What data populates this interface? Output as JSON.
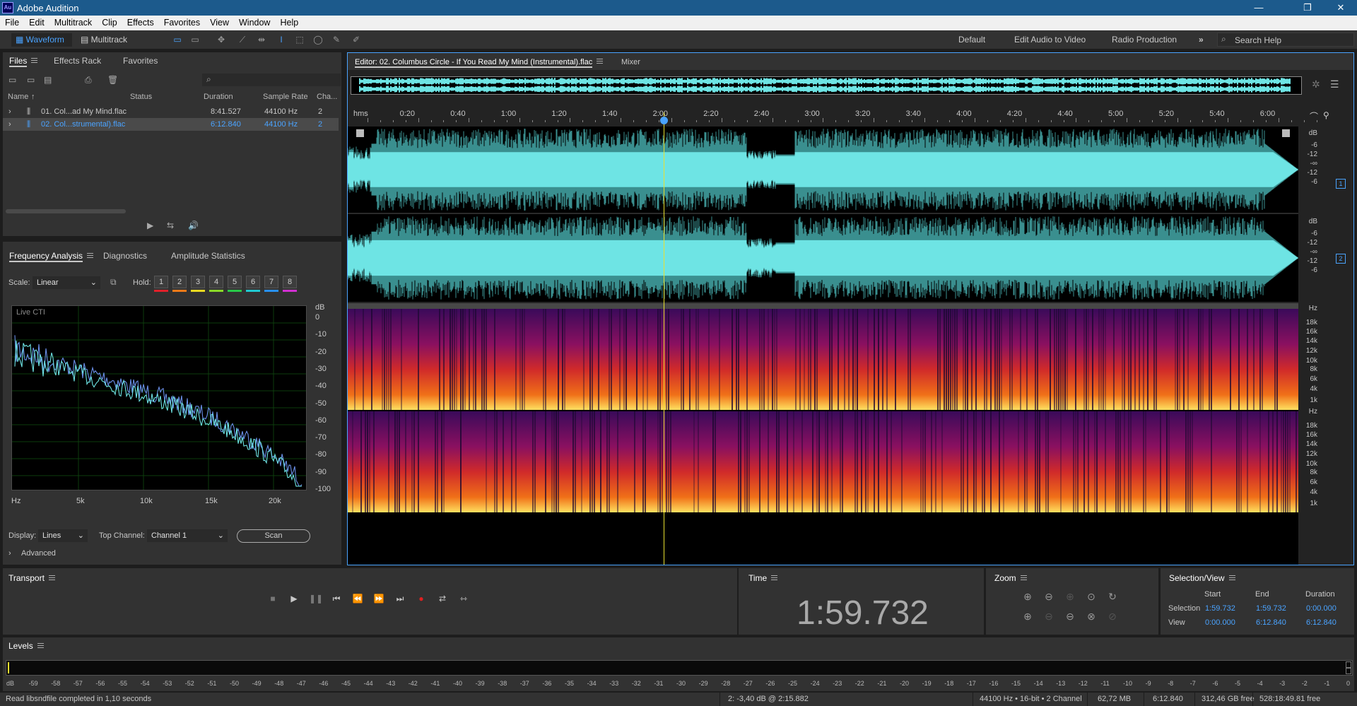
{
  "app": {
    "title": "Adobe Audition",
    "logo": "Au"
  },
  "window_controls": [
    "—",
    "❐",
    "✕"
  ],
  "menu": [
    "File",
    "Edit",
    "Multitrack",
    "Clip",
    "Effects",
    "Favorites",
    "View",
    "Window",
    "Help"
  ],
  "toolbar": {
    "waveform": "Waveform",
    "multitrack": "Multitrack",
    "workspaces": [
      "Default",
      "Edit Audio to Video",
      "Radio Production"
    ],
    "more": "»",
    "search_placeholder": "Search Help"
  },
  "files_panel": {
    "tabs": [
      "Files",
      "Effects Rack",
      "Favorites"
    ],
    "columns": [
      "Name",
      "Status",
      "Duration",
      "Sample Rate",
      "Cha..."
    ],
    "rows": [
      {
        "name": "01. Col...ad My Mind.flac",
        "status": "",
        "duration": "8:41.527",
        "rate": "44100 Hz",
        "ch": "2"
      },
      {
        "name": "02. Col...strumental).flac",
        "status": "",
        "duration": "6:12.840",
        "rate": "44100 Hz",
        "ch": "2"
      }
    ],
    "search_icon": "search-icon"
  },
  "freq_panel": {
    "tabs": [
      "Frequency Analysis",
      "Diagnostics",
      "Amplitude Statistics"
    ],
    "scale_label": "Scale:",
    "scale_value": "Linear",
    "hold_label": "Hold:",
    "hold": [
      "1",
      "2",
      "3",
      "4",
      "5",
      "6",
      "7",
      "8"
    ],
    "hold_colors": [
      "#e0202a",
      "#f07a18",
      "#e8d820",
      "#8ad828",
      "#28c848",
      "#20c8d0",
      "#2890f0",
      "#d030d0"
    ],
    "live": "Live CTI",
    "db_unit": "dB",
    "db_ticks": [
      "0",
      "-10",
      "-20",
      "-30",
      "-40",
      "-50",
      "-60",
      "-70",
      "-80",
      "-90",
      "-100"
    ],
    "hz_ticks": [
      "Hz",
      "5k",
      "10k",
      "15k",
      "20k"
    ],
    "display_label": "Display:",
    "display_value": "Lines",
    "top_channel_label": "Top Channel:",
    "top_channel_value": "Channel 1",
    "scan": "Scan",
    "advanced": "Advanced"
  },
  "editor": {
    "tab": "Editor: 02. Columbus Circle - If You Read My Mind (Instrumental).flac",
    "mixer": "Mixer",
    "ruler": [
      "hms",
      "0:20",
      "0:40",
      "1:00",
      "1:20",
      "1:40",
      "2:00",
      "2:20",
      "2:40",
      "3:00",
      "3:20",
      "3:40",
      "4:00",
      "4:20",
      "4:40",
      "5:00",
      "5:20",
      "5:40",
      "6:00"
    ],
    "db_labels": [
      "dB",
      "-6",
      "-12",
      "-∞",
      "-12",
      "-6"
    ],
    "channels": [
      "1",
      "2"
    ],
    "hz_labels": [
      "Hz",
      "18k",
      "16k",
      "14k",
      "12k",
      "10k",
      "8k",
      "6k",
      "4k",
      "1k"
    ],
    "playhead_fraction": 0.321,
    "colors": {
      "wave": "#6ee4e4",
      "playhead": "#e8e030",
      "accent": "#4aa3ff"
    }
  },
  "transport": {
    "title": "Transport",
    "buttons": [
      "stop-icon",
      "play-icon",
      "pause-icon",
      "skip-start-icon",
      "rewind-icon",
      "fast-forward-icon",
      "skip-end-icon",
      "record-icon",
      "loop-icon",
      "skip-selection-icon"
    ]
  },
  "time": {
    "title": "Time",
    "value": "1:59.732"
  },
  "zoom": {
    "title": "Zoom"
  },
  "selview": {
    "title": "Selection/View",
    "cols": [
      "Start",
      "End",
      "Duration"
    ],
    "rows": [
      {
        "label": "Selection",
        "start": "1:59.732",
        "end": "1:59.732",
        "dur": "0:00.000"
      },
      {
        "label": "View",
        "start": "0:00.000",
        "end": "6:12.840",
        "dur": "6:12.840"
      }
    ]
  },
  "levels": {
    "title": "Levels",
    "ticks": [
      "dB",
      "-59",
      "-58",
      "-57",
      "-56",
      "-55",
      "-54",
      "-53",
      "-52",
      "-51",
      "-50",
      "-49",
      "-48",
      "-47",
      "-46",
      "-45",
      "-44",
      "-43",
      "-42",
      "-41",
      "-40",
      "-39",
      "-38",
      "-37",
      "-36",
      "-35",
      "-34",
      "-33",
      "-32",
      "-31",
      "-30",
      "-29",
      "-28",
      "-27",
      "-26",
      "-25",
      "-24",
      "-23",
      "-22",
      "-21",
      "-20",
      "-19",
      "-18",
      "-17",
      "-16",
      "-15",
      "-14",
      "-13",
      "-12",
      "-11",
      "-10",
      "-9",
      "-8",
      "-7",
      "-6",
      "-5",
      "-4",
      "-3",
      "-2",
      "-1",
      "0"
    ]
  },
  "status": {
    "left": "Read libsndfile completed in 1,10 seconds",
    "mid": "2: -3,40 dB @ 2:15.882",
    "format": "44100 Hz • 16-bit • 2 Channel",
    "size": "62,72 MB",
    "dur": "6:12.840",
    "free": "312,46 GB free",
    "time_free": "528:18:49.81 free"
  }
}
